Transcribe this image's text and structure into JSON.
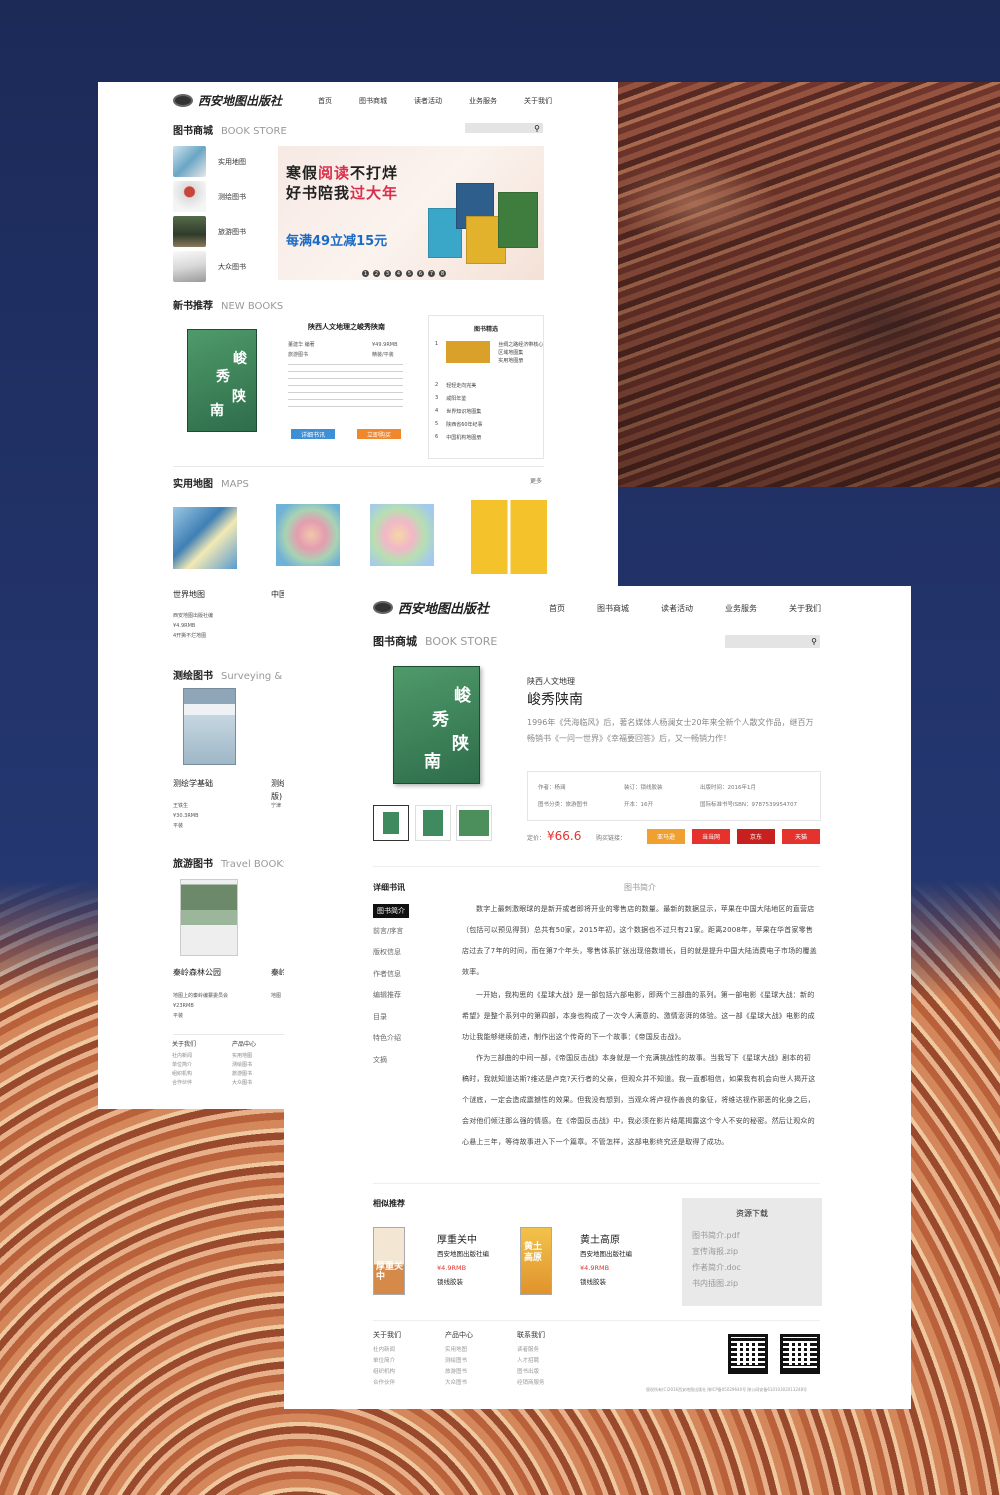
{
  "site": {
    "logo_text": "西安地图出版社"
  },
  "nav": [
    "首页",
    "图书商城",
    "读者活动",
    "业务服务",
    "关于我们"
  ],
  "store": {
    "title": "图书商城",
    "title_en": "BOOK STORE"
  },
  "categories": [
    "实用地图",
    "测绘图书",
    "旅游图书",
    "大众图书"
  ],
  "banner": {
    "line1_a": "寒假",
    "line1_b": "阅读",
    "line1_c": "不打烊",
    "line2_a": "好书陪我",
    "line2_b": "过大年",
    "offer": "每满49立减15元",
    "dots": [
      "1",
      "2",
      "3",
      "4",
      "5",
      "6",
      "7",
      "8"
    ]
  },
  "new_books": {
    "title": "新书推荐",
    "title_en": "NEW BOOKS",
    "book_title": "陕西人文地理之峻秀陕南",
    "author": "董建华 编著",
    "publisher": "旅游图书",
    "price": "¥49.9RMB",
    "binding": "精装/平装",
    "btn_detail": "详细书讯",
    "btn_buy": "立即购买",
    "picks_title": "图书精选",
    "picks": [
      {
        "n": "1",
        "t": "丝绸之路经济带核心区域地图集"
      },
      {
        "n": "2",
        "t": "轻轻走向完美"
      },
      {
        "n": "3",
        "t": "咸阳年鉴"
      },
      {
        "n": "4",
        "t": "世界知识地图集"
      },
      {
        "n": "5",
        "t": "陕西省60年纪事"
      },
      {
        "n": "6",
        "t": "中国机构地图册"
      }
    ],
    "pick1_sub": "实用地图册"
  },
  "maps": {
    "title": "实用地图",
    "title_en": "MAPS",
    "more": "更多",
    "items": [
      {
        "title": "世界地图",
        "pub": "西安地图出版社编",
        "price": "¥4.9RMB",
        "note": "4开撕不烂地图"
      },
      {
        "title": "中国"
      }
    ]
  },
  "survey": {
    "title": "测绘图书",
    "title_en": "Surveying & M",
    "items": [
      {
        "title": "测绘学基础",
        "pub": "王铁生",
        "price": "¥30.3RMB",
        "note": "平装"
      },
      {
        "title": "测绘",
        "title2": "版)",
        "pub": "宁津"
      }
    ]
  },
  "travel": {
    "title": "旅游图书",
    "title_en": "Travel BOOKS",
    "items": [
      {
        "title": "秦岭森林公园",
        "pub": "地图上的秦岭编纂委员会",
        "price": "¥23RMB",
        "note": "平装"
      },
      {
        "title": "秦岭",
        "pub": "地图"
      }
    ]
  },
  "footer1": {
    "col1": {
      "h": "关于我们",
      "items": [
        "社内新闻",
        "单位简介",
        "组织机构",
        "合作伙伴"
      ]
    },
    "col2": {
      "h": "产品中心",
      "items": [
        "实用地图",
        "测绘图书",
        "旅游图书",
        "大众图书"
      ]
    }
  },
  "detail": {
    "series": "陕西人文地理",
    "title": "峻秀陕南",
    "desc": "1996年《凭海临风》后，著名媒体人杨澜女士20年来全新个人散文作品，继百万畅销书《一问一世界》《幸福要回答》后，又一畅销力作！",
    "spec": {
      "author": "作者：杨澜",
      "binding": "装订：锁线胶装",
      "date": "出版时间：2016年1月",
      "category": "图书分类：旅游图书",
      "format": "开本：16开",
      "isbn": "国际标准书号ISBN：9787539954707"
    },
    "price_label": "定价：",
    "price": "¥66.6",
    "buy_label": "购买链接：",
    "shops": [
      "亚马逊",
      "当当网",
      "京东",
      "天猫"
    ],
    "cover_text": [
      "峻",
      "秀",
      "陕",
      "南"
    ]
  },
  "tabs": {
    "heading": "详细书讯",
    "items": [
      "图书简介",
      "前言/序言",
      "版权信息",
      "作者信息",
      "编辑推荐",
      "目录",
      "特色介绍",
      "文摘"
    ],
    "content_title": "图书简介"
  },
  "intro": [
    "数字上最刺激眼球的是新开或者即将开业的零售店的数量。最新的数据显示，苹果在中国大陆地区的直营店（包括可以预见得到）总共有50家，2015年初，这个数据也不过只有21家。距离2008年，苹果在华首家零售店过去了7年的时间，而在第7个年头，零售体系扩张出现倍数增长，目的就是提升中国大陆消费电子市场的覆盖效率。",
    "一开始，我构思的《星球大战》是一部包括六部电影，即两个三部曲的系列。第一部电影《星球大战：新的希望》是整个系列中的第四部，本身也构成了一次令人满意的、激情澎湃的体验。这一部《星球大战》电影的成功让我能够继续前进，制作出这个传奇的下一个故事：《帝国反击战》。",
    "作为三部曲的中间一部，《帝国反击战》本身就是一个充满挑战性的故事。当我写下《星球大战》剧本的初稿时，我就知道达斯?维达是卢克?天行者的父亲，但观众并不知道。我一直都相信，如果我有机会向世人揭开这个谜底，一定会造成震撼性的效果。但我没有想到，当观众将卢视作善良的象征，将维达视作邪恶的化身之后，会对他们倾注那么强的情感。在《帝国反击战》中，我必须在影片结尾揭露这个令人不安的秘密。然后让观众的心悬上三年，等待故事进入下一个篇章。不管怎样，这部电影终究还是取得了成功。"
  ],
  "related": {
    "title": "相似推荐",
    "items": [
      {
        "title": "厚重关中",
        "pub": "西安地图出版社编",
        "price": "¥4.9RMB",
        "binding": "锁线胶装",
        "cover": "厚重关中"
      },
      {
        "title": "黄土高原",
        "pub": "西安地图出版社编",
        "price": "¥4.9RMB",
        "binding": "锁线胶装",
        "cover": "黄土高原"
      }
    ]
  },
  "downloads": {
    "title": "资源下载",
    "files": [
      "图书简介.pdf",
      "宣传海报.zip",
      "作者简介.doc",
      "书内插图.zip"
    ]
  },
  "footer2": {
    "col1": {
      "h": "关于我们",
      "items": [
        "社内新闻",
        "单位简介",
        "组织机构",
        "合作伙伴"
      ]
    },
    "col2": {
      "h": "产品中心",
      "items": [
        "实用地图",
        "测绘图书",
        "旅游图书",
        "大众图书"
      ]
    },
    "col3": {
      "h": "联系我们",
      "items": [
        "读者服务",
        "人才招聘",
        "图书出版",
        "经销商服务"
      ]
    },
    "copyright": "版权所有(C)2016西安地图出版社 陕ICP备05029640号 陕公网安备61010302013248号"
  },
  "colors": {
    "accent_red": "#e5322d",
    "blue_btn": "#3d8fd6",
    "orange_btn": "#f0872c",
    "amazon": "#f0a030"
  }
}
